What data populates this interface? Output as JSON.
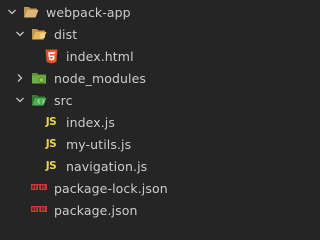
{
  "explorer": {
    "root": {
      "label": "webpack-app",
      "icon": "folder-open-icon",
      "expanded": true
    },
    "items": [
      {
        "label": "dist",
        "icon": "folder-dist-open-icon",
        "expanded": true
      },
      {
        "label": "index.html",
        "icon": "html5-icon"
      },
      {
        "label": "node_modules",
        "icon": "folder-node-icon",
        "expanded": false
      },
      {
        "label": "src",
        "icon": "folder-src-open-icon",
        "expanded": true
      },
      {
        "label": "index.js",
        "icon": "js-file-icon"
      },
      {
        "label": "my-utils.js",
        "icon": "js-file-icon"
      },
      {
        "label": "navigation.js",
        "icon": "js-file-icon"
      },
      {
        "label": "package-lock.json",
        "icon": "npm-icon"
      },
      {
        "label": "package.json",
        "icon": "npm-icon"
      }
    ],
    "colors": {
      "background": "#252526",
      "text": "#cccccc",
      "folder": "#c09553",
      "html": "#e44d26",
      "node": "#8cc84b",
      "src_folder": "#4caf50",
      "js": "#e8d44d",
      "npm": "#cb3837"
    }
  }
}
